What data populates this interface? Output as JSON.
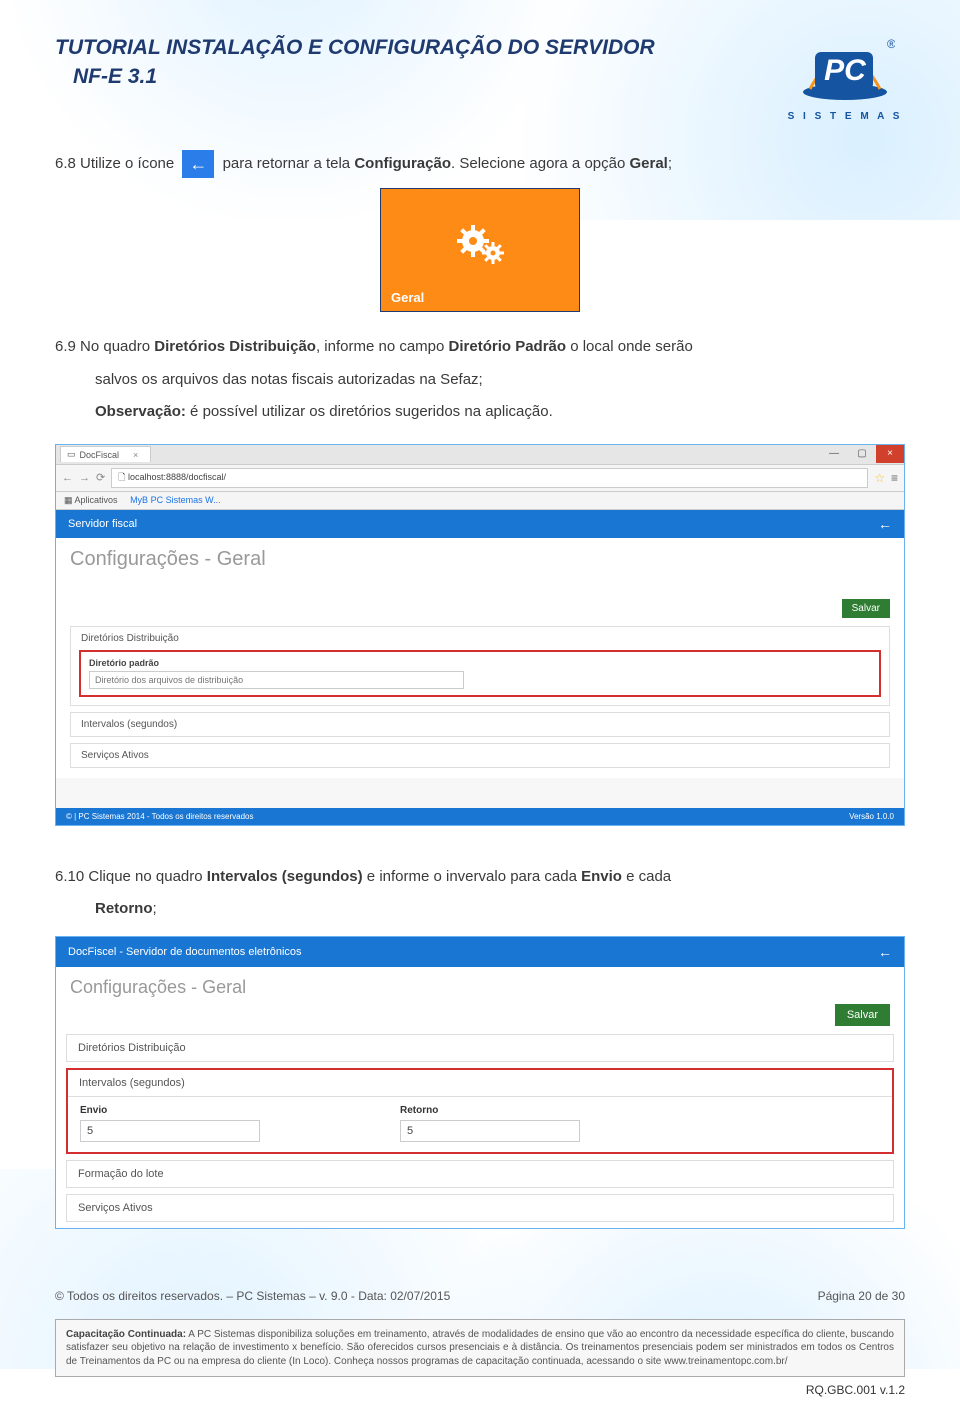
{
  "doc": {
    "title_line1": "TUTORIAL INSTALAÇÃO E CONFIGURAÇÃO DO SERVIDOR",
    "title_line2": "NF-E 3.1"
  },
  "logo": {
    "letters": "PC",
    "reg": "®",
    "sub": "S I S T E M A S"
  },
  "step68": {
    "prefix": "6.8 Utilize o ícone",
    "suffix_a": "para retornar a tela ",
    "bold_a": "Configuração",
    "suffix_b": ". Selecione agora a opção ",
    "bold_b": "Geral",
    "suffix_c": ";"
  },
  "tile": {
    "label": "Geral"
  },
  "step69": {
    "line1a": "6.9 No quadro ",
    "b1": "Diretórios Distribuição",
    "line1b": ", informe no campo ",
    "b2": "Diretório Padrão",
    "line1c": " o local onde serão",
    "line2": "salvos os arquivos das notas fiscais autorizadas na Sefaz;",
    "obs_label": "Observação:",
    "obs_text": " é possível utilizar os  diretórios sugeridos na aplicação."
  },
  "shot1": {
    "tab": "DocFiscal",
    "url": "localhost:8888/docfiscal/",
    "apps_label": "Aplicativos",
    "app_link": "MyB PC Sistemas W...",
    "bar_title": "Servidor fiscal",
    "cfg_title": "Configurações - Geral",
    "salvar": "Salvar",
    "sec1": "Diretórios Distribuição",
    "field_label": "Diretório padrão",
    "field_placeholder": "Diretório dos arquivos de distribuição",
    "sec2": "Intervalos (segundos)",
    "sec3": "Serviços Ativos",
    "foot_left": "© | PC Sistemas 2014 - Todos os direitos reservados",
    "foot_right": "Versão 1.0.0"
  },
  "step610": {
    "a": "6.10 Clique no quadro ",
    "b1": "Intervalos (segundos)",
    "b": " e informe o invervalo para cada ",
    "b2": "Envio",
    "c": " e cada",
    "b3": "Retorno",
    "d": ";"
  },
  "shot2": {
    "bar_title": "DocFiscel - Servidor de documentos eletrônicos",
    "cfg_title": "Configurações - Geral",
    "salvar": "Salvar",
    "sec1": "Diretórios Distribuição",
    "sec2_head": "Intervalos (segundos)",
    "envio_label": "Envio",
    "envio_val": "5",
    "retorno_label": "Retorno",
    "retorno_val": "5",
    "sec3": "Formação do lote",
    "sec4": "Serviços Ativos"
  },
  "footer": {
    "left": "© Todos os direitos reservados. – PC Sistemas – v. 9.0 - Data: 02/07/2015",
    "right": "Página 20 de 30"
  },
  "cap": {
    "bold": "Capacitação Continuada:",
    "text": " A PC Sistemas disponibiliza soluções em treinamento, através de modalidades de ensino que vão ao encontro da necessidade específica do cliente, buscando satisfazer seu objetivo na relação de investimento x benefício. São oferecidos cursos presenciais e à distância. Os treinamentos presenciais podem ser ministrados em todos os Centros de Treinamentos da PC ou na empresa do cliente (In Loco). Conheça nossos programas de capacitação continuada, acessando o site www.treinamentopc.com.br/"
  },
  "rq": "RQ.GBC.001 v.1.2"
}
